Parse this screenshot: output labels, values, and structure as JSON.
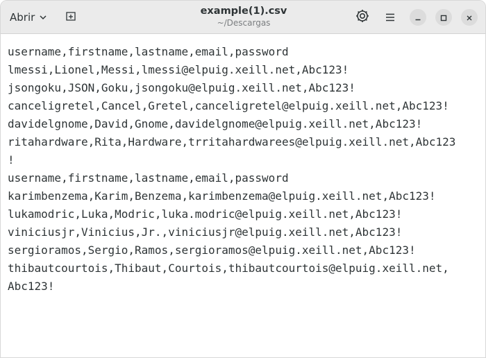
{
  "header": {
    "open_label": "Abrir",
    "title": "example(1).csv",
    "subtitle": "~/Descargas"
  },
  "icons": {
    "open_menu": "chevron-down-icon",
    "new_tab": "new-tab-icon",
    "settings": "settings-icon",
    "menu": "hamburger-menu-icon",
    "minimize": "minimize-icon",
    "maximize": "maximize-icon",
    "close": "close-icon"
  },
  "editor": {
    "lines": [
      "username,firstname,lastname,email,password",
      "lmessi,Lionel,Messi,lmessi@elpuig.xeill.net,Abc123!",
      "jsongoku,JSON,Goku,jsongoku@elpuig.xeill.net,Abc123!",
      "canceligretel,Cancel,Gretel,canceligretel@elpuig.xeill.net,Abc123!",
      "davidelgnome,David,Gnome,davidelgnome@elpuig.xeill.net,Abc123!",
      "ritahardware,Rita,Hardware,trritahardwarees@elpuig.xeill.net,Abc123",
      "!",
      "username,firstname,lastname,email,password",
      "karimbenzema,Karim,Benzema,karimbenzema@elpuig.xeill.net,Abc123!",
      "lukamodric,Luka,Modric,luka.modric@elpuig.xeill.net,Abc123!",
      "viniciusjr,Vinicius,Jr.,viniciusjr@elpuig.xeill.net,Abc123!",
      "sergioramos,Sergio,Ramos,sergioramos@elpuig.xeill.net,Abc123!",
      "thibautcourtois,Thibaut,Courtois,thibautcourtois@elpuig.xeill.net,",
      "Abc123!"
    ]
  }
}
